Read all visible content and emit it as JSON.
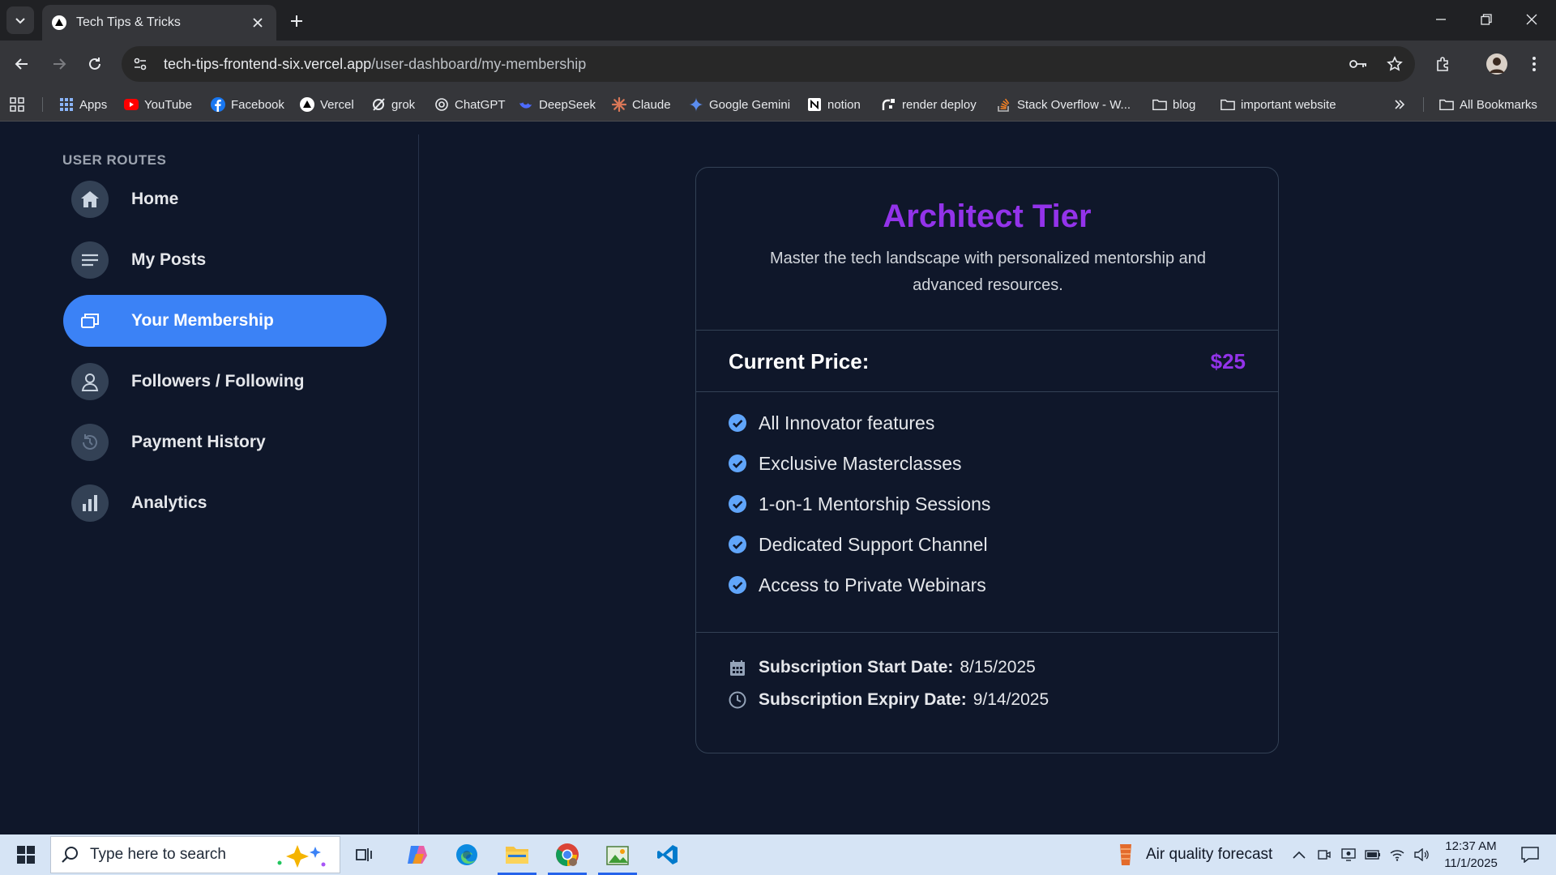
{
  "browser": {
    "tab_title": "Tech Tips & Tricks",
    "url_host": "tech-tips-frontend-six.vercel.app",
    "url_path": "/user-dashboard/my-membership"
  },
  "bookmarks": [
    {
      "label": "Apps",
      "icon": "apps-grid-icon"
    },
    {
      "label": "YouTube",
      "icon": "youtube-icon"
    },
    {
      "label": "Facebook",
      "icon": "facebook-icon"
    },
    {
      "label": "Vercel",
      "icon": "vercel-icon"
    },
    {
      "label": "grok",
      "icon": "grok-icon"
    },
    {
      "label": "ChatGPT",
      "icon": "chatgpt-icon"
    },
    {
      "label": "DeepSeek",
      "icon": "deepseek-icon"
    },
    {
      "label": "Claude",
      "icon": "claude-icon"
    },
    {
      "label": "Google Gemini",
      "icon": "gemini-icon"
    },
    {
      "label": "notion",
      "icon": "notion-icon"
    },
    {
      "label": "render deploy",
      "icon": "render-icon"
    },
    {
      "label": "Stack Overflow - W...",
      "icon": "stackoverflow-icon"
    },
    {
      "label": "blog",
      "icon": "folder-icon"
    },
    {
      "label": "important website",
      "icon": "folder-icon"
    }
  ],
  "all_bookmarks_label": "All Bookmarks",
  "sidebar": {
    "heading": "USER ROUTES",
    "items": [
      {
        "label": "Home",
        "icon": "home-icon",
        "active": false
      },
      {
        "label": "My Posts",
        "icon": "posts-icon",
        "active": false
      },
      {
        "label": "Your Membership",
        "icon": "membership-icon",
        "active": true
      },
      {
        "label": "Followers / Following",
        "icon": "user-icon",
        "active": false
      },
      {
        "label": "Payment History",
        "icon": "history-icon",
        "active": false
      },
      {
        "label": "Analytics",
        "icon": "analytics-icon",
        "active": false
      }
    ]
  },
  "membership": {
    "tier_name": "Architect Tier",
    "description": "Master the tech landscape with personalized mentorship and advanced resources.",
    "price_label": "Current Price:",
    "price": "$25",
    "features": [
      "All Innovator features",
      "Exclusive Masterclasses",
      "1-on-1 Mentorship Sessions",
      "Dedicated Support Channel",
      "Access to Private Webinars"
    ],
    "start_label": "Subscription Start Date:",
    "start_date": "8/15/2025",
    "expiry_label": "Subscription Expiry Date:",
    "expiry_date": "9/14/2025"
  },
  "taskbar": {
    "search_placeholder": "Type here to search",
    "weather_text": "Air quality forecast",
    "time": "12:37 AM",
    "date": "11/1/2025"
  },
  "colors": {
    "accent_blue": "#3b82f6",
    "tier_purple": "#9333ea",
    "page_bg": "#0f172a"
  }
}
